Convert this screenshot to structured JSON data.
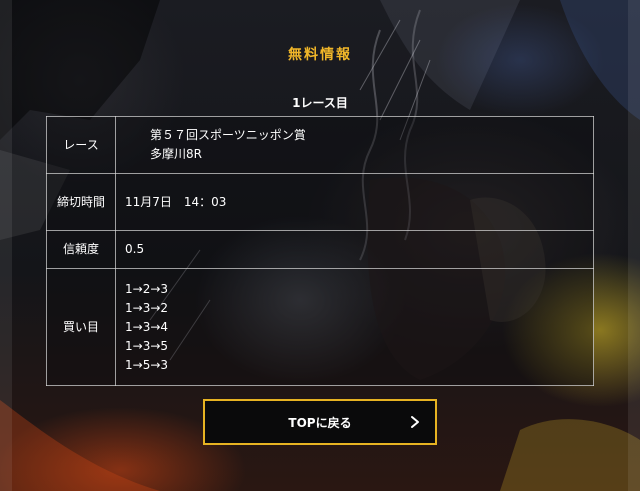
{
  "section": {
    "title": "無料情報"
  },
  "race": {
    "heading": "1レース目",
    "rows": [
      {
        "label": "レース",
        "value_lines": [
          "第５７回スポーツニッポン賞",
          "多摩川8R"
        ]
      },
      {
        "label": "締切時間",
        "value_lines": [
          "11月7日　14：03"
        ]
      },
      {
        "label": "信頼度",
        "value_lines": [
          "0.5"
        ]
      },
      {
        "label": "買い目",
        "value_lines": [
          "1→2→3",
          "1→3→2",
          "1→3→4",
          "1→3→5",
          "1→5→3"
        ]
      }
    ]
  },
  "button": {
    "label": "TOPに戻る",
    "icon": "chevron-right-icon"
  },
  "colors": {
    "accent": "#f0b629",
    "button_border": "#e7b322",
    "text": "#ffffff"
  }
}
